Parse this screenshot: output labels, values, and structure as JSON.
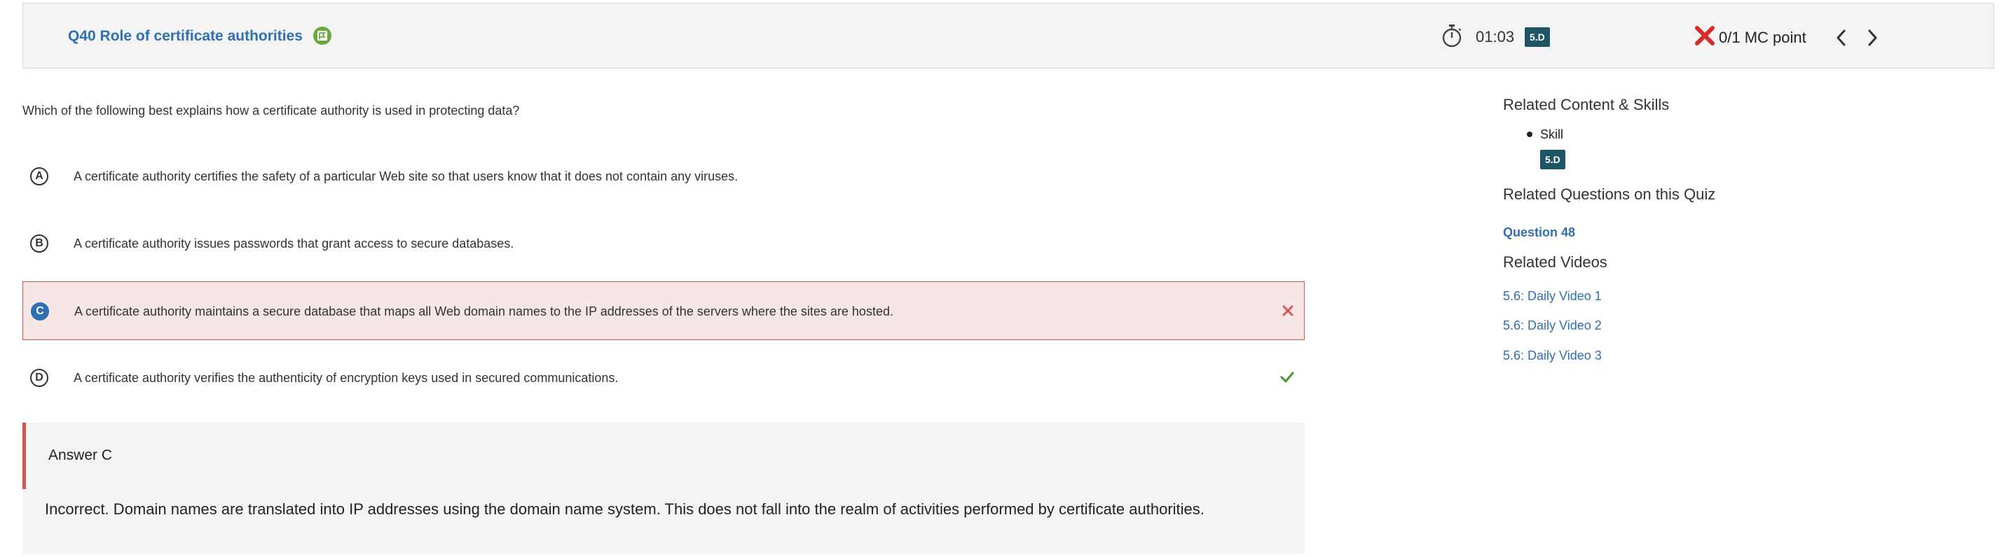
{
  "header": {
    "question_title": "Q40 Role of certificate authorities",
    "timer": "01:03",
    "skill_badge": "5.D",
    "score": "0/1 MC point"
  },
  "question": {
    "prompt": "Which of the following best explains how a certificate authority is used in protecting data?",
    "options": [
      {
        "letter": "A",
        "text": "A certificate authority certifies the safety of a particular Web site so that users know that it does not contain any viruses."
      },
      {
        "letter": "B",
        "text": "A certificate authority issues passwords that grant access to secure databases."
      },
      {
        "letter": "C",
        "text": "A certificate authority maintains a secure database that maps all Web domain names to the IP addresses of the servers where the sites are hosted.",
        "selected": true,
        "mark": "incorrect"
      },
      {
        "letter": "D",
        "text": "A certificate authority verifies the authenticity of encryption keys used in secured communications.",
        "mark": "correct"
      }
    ]
  },
  "answer": {
    "label": "Answer C",
    "explanation": "Incorrect. Domain names are translated into IP addresses using the domain name system. This does not fall into the realm of activities performed by certificate authorities."
  },
  "sidebar": {
    "related_content_heading": "Related Content & Skills",
    "skill_label": "Skill",
    "skill_badge": "5.D",
    "related_questions_heading": "Related Questions on this Quiz",
    "related_question_link": "Question 48",
    "related_videos_heading": "Related Videos",
    "videos": [
      "5.6: Daily Video 1",
      "5.6: Daily Video 2",
      "5.6: Daily Video 3"
    ]
  },
  "colors": {
    "link_blue": "#2f6fb3",
    "badge_teal": "#1f5467",
    "incorrect_red": "#d9534f",
    "correct_green": "#4a9a2f",
    "selected_bg": "#f6e6e6"
  },
  "icons": {
    "title_icon": "flag-icon",
    "timer_icon": "stopwatch-icon",
    "score_icon": "red-x-icon",
    "prev": "chevron-left-icon",
    "next": "chevron-right-icon",
    "incorrect_mark": "x-mark-icon",
    "correct_mark": "check-mark-icon"
  }
}
